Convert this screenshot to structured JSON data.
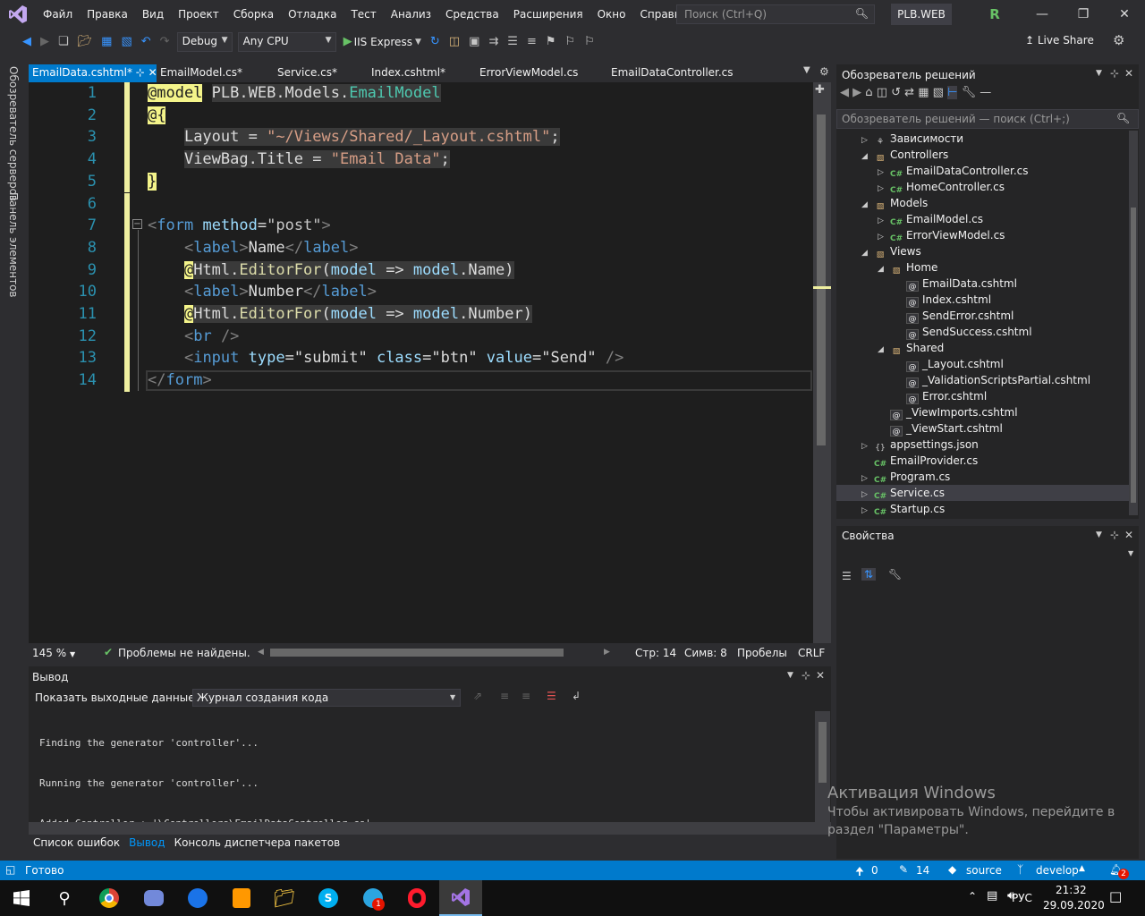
{
  "menu": {
    "items": [
      "Файл",
      "Правка",
      "Вид",
      "Проект",
      "Сборка",
      "Отладка",
      "Тест",
      "Анализ",
      "Средства",
      "Расширения",
      "Окно",
      "Справка"
    ],
    "search_placeholder": "Поиск (Ctrl+Q)",
    "solution_name": "PLB.WEB",
    "avatar_letter": "R"
  },
  "toolbar": {
    "config": "Debug",
    "platform": "Any CPU",
    "run_target": "IIS Express",
    "live_share": "Live Share"
  },
  "left_strip": {
    "server_explorer": "Обозреватель серверов",
    "toolbox": "Панель элементов"
  },
  "tabs": [
    "EmailData.cshtml*",
    "EmailModel.cs*",
    "Service.cs*",
    "Index.cshtml*",
    "ErrorViewModel.cs",
    "EmailDataController.cs"
  ],
  "editor": {
    "line_numbers": [
      "1",
      "2",
      "3",
      "4",
      "5",
      "6",
      "7",
      "8",
      "9",
      "10",
      "11",
      "12",
      "13",
      "14"
    ],
    "zoom": "145 %",
    "problems": "Проблемы не найдены.",
    "line": "Стр: 14",
    "col": "Симв: 8",
    "whitespace": "Пробелы",
    "eol": "CRLF"
  },
  "solution_explorer": {
    "title": "Обозреватель решений",
    "search_placeholder": "Обозреватель решений — поиск (Ctrl+;)",
    "items": [
      "Зависимости",
      "Controllers",
      "EmailDataController.cs",
      "HomeController.cs",
      "Models",
      "EmailModel.cs",
      "ErrorViewModel.cs",
      "Views",
      "Home",
      "EmailData.cshtml",
      "Index.cshtml",
      "SendError.cshtml",
      "SendSuccess.cshtml",
      "Shared",
      "_Layout.cshtml",
      "_ValidationScriptsPartial.cshtml",
      "Error.cshtml",
      "_ViewImports.cshtml",
      "_ViewStart.cshtml",
      "appsettings.json",
      "EmailProvider.cs",
      "Program.cs",
      "Service.cs",
      "Startup.cs"
    ]
  },
  "properties": {
    "title": "Свойства"
  },
  "output": {
    "title": "Вывод",
    "show_label": "Показать выходные данные из:",
    "source": "Журнал создания кода",
    "lines": [
      "Finding the generator 'controller'...",
      "Running the generator 'controller'...",
      "Added Controller : '\\Controllers\\EmailDataController.cs'."
    ]
  },
  "bottom_tabs": [
    "Список ошибок",
    "Вывод",
    "Консоль диспетчера пакетов"
  ],
  "watermark": {
    "title": "Активация Windows",
    "line1": "Чтобы активировать Windows, перейдите в",
    "line2": "раздел \"Параметры\"."
  },
  "status": {
    "ready": "Готово",
    "up": "0",
    "edits": "14",
    "repo": "source",
    "branch": "develop",
    "notif": "2"
  },
  "taskbar": {
    "lang": "РУС",
    "time": "21:32",
    "date": "29.09.2020",
    "telegram_badge": "1"
  },
  "colors": {
    "accent": "#007acc",
    "background": "#2d2d30",
    "editor": "#1e1e1e"
  }
}
